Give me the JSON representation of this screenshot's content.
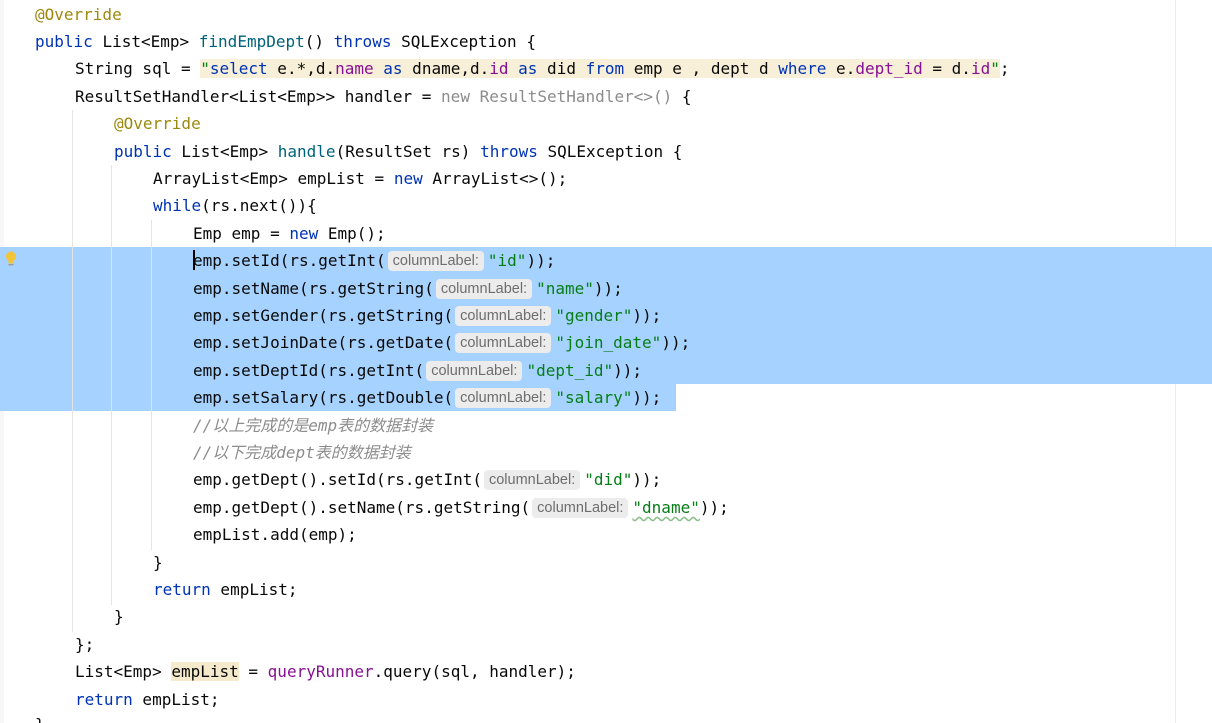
{
  "editor": {
    "language": "java",
    "gutter": {
      "intention_bulb": "lightbulb-icon"
    },
    "annotation_override": "@Override",
    "method_signature": {
      "kw_public": "public",
      "return_type": "List<Emp>",
      "method_name": "findEmpDept",
      "params": "()",
      "kw_throws": "throws",
      "exception": "SQLException {"
    },
    "sql_line": {
      "type": "String",
      "rest": " sql = ",
      "q1": "\"",
      "w_select": "select",
      "p1": " e.*,d.",
      "c_name": "name",
      "p2": " ",
      "w_as1": "as",
      "p3": " dname,d.",
      "c_id": "id",
      "p4": " ",
      "w_as2": "as",
      "p5": " did ",
      "w_from": "from",
      "p6": " emp e , dept d ",
      "w_where": "where",
      "p7": " e.",
      "c_dept_id": "dept_id",
      "p8": " = d.",
      "c_id2": "id",
      "q2": "\"",
      "semi": ";"
    },
    "handler_line": {
      "decl": "ResultSetHandler<List<Emp>> handler = ",
      "kw_new": "new",
      "anon": " ResultSetHandler<>()",
      "brace": " {"
    },
    "inner_override": "@Override",
    "handle_sig": {
      "kw_public": "public",
      "type": " List<Emp> ",
      "name": "handle",
      "params": "(ResultSet rs) ",
      "kw_throws": "throws",
      "exc": " SQLException {"
    },
    "arraylist_line": {
      "decl": "ArrayList<Emp> empList = ",
      "kw_new": "new",
      "rest": " ArrayList<>();"
    },
    "while_line": {
      "kw_while": "while",
      "rest": "(rs.next()){"
    },
    "emp_line": {
      "decl": "Emp emp = ",
      "kw_new": "new",
      "rest": " Emp();"
    },
    "hint_label": "columnLabel:",
    "setters": [
      {
        "call": "emp.setId(rs.getInt(",
        "arg": "\"id\"",
        "end": "));"
      },
      {
        "call": "emp.setName(rs.getString(",
        "arg": "\"name\"",
        "end": "));"
      },
      {
        "call": "emp.setGender(rs.getString(",
        "arg": "\"gender\"",
        "end": "));"
      },
      {
        "call": "emp.setJoinDate(rs.getDate(",
        "arg": "\"join_date\"",
        "end": "));"
      },
      {
        "call": "emp.setDeptId(rs.getInt(",
        "arg": "\"dept_id\"",
        "end": "));"
      },
      {
        "call": "emp.setSalary(rs.getDouble(",
        "arg": "\"salary\"",
        "end": "));"
      }
    ],
    "comment1": "//以上完成的是emp表的数据封装",
    "comment2": "//以下完成dept表的数据封装",
    "dept_setters": [
      {
        "call": "emp.getDept().setId(rs.getInt(",
        "arg": "\"did\"",
        "end": "));"
      },
      {
        "call": "emp.getDept().setName(rs.getString(",
        "arg": "\"dname\"",
        "end": "));"
      }
    ],
    "add_line": "empList.add(emp);",
    "close_while": "}",
    "return_inner": {
      "kw_return": "return",
      "rest": " empList;"
    },
    "close_handle": "}",
    "close_anon": "};",
    "query_line": {
      "type": "List<Emp> ",
      "var": "empList",
      "eq": " = ",
      "field": "queryRunner",
      "rest": ".query(sql, handler);"
    },
    "return_outer": {
      "kw_return": "return",
      "rest": " empList;"
    },
    "close_method": "}"
  }
}
